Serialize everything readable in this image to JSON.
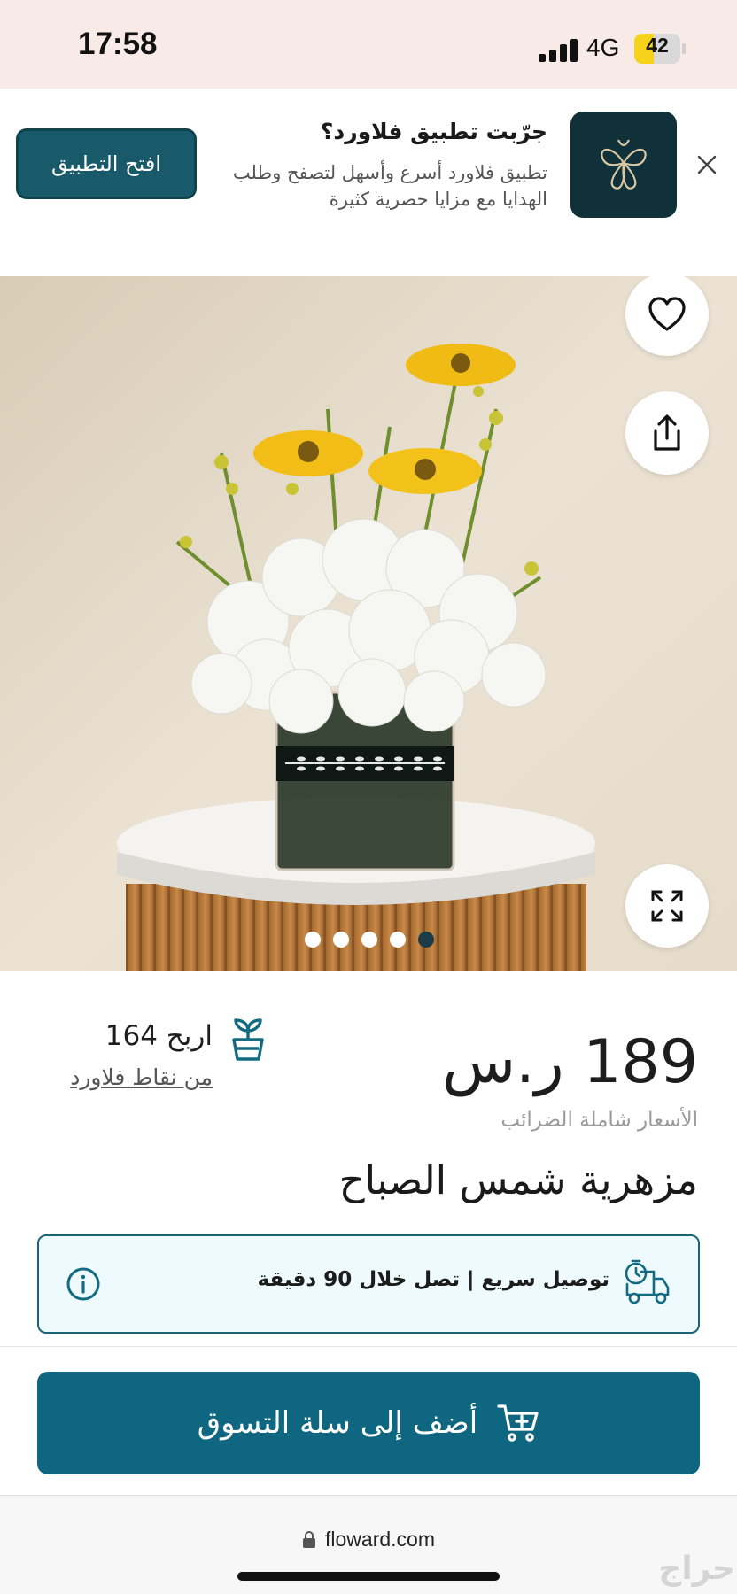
{
  "status_bar": {
    "time": "17:58",
    "network": "4G",
    "battery": "42",
    "battery_level": 0.42
  },
  "app_banner": {
    "title": "جرّبت تطبيق فلاورد؟",
    "description": "تطبيق فلاورد أسرع وأسهل لتصفح وطلب الهدايا مع مزايا حصرية كثيرة",
    "open_button": "افتح التطبيق",
    "icons": {
      "close": "close-icon",
      "logo": "floward-logo-icon"
    }
  },
  "gallery": {
    "image": "yellow gerbera and white chrysanthemum arrangement in glass vase",
    "slide_count": 5,
    "active_slide": 5,
    "icons": [
      "heart-icon",
      "share-icon",
      "expand-icon"
    ]
  },
  "product": {
    "price": "189 ر.س",
    "tax_note": "الأسعار شاملة الضرائب",
    "points_earn": "اربح 164",
    "points_link": "من نقاط فلاورد",
    "title": "مزهرية شمس الصباح"
  },
  "delivery": {
    "text": "توصيل سريع | تصل خلال 90 دقيقة"
  },
  "cart": {
    "button": "أضف إلى سلة التسوق"
  },
  "browser": {
    "url": "floward.com"
  },
  "watermark": {
    "text": "حراج"
  },
  "colors": {
    "primary": "#0f6680",
    "banner_button": "#185a6a",
    "status_bg": "#f8ebe7",
    "delivery_bg": "#eefafd"
  }
}
